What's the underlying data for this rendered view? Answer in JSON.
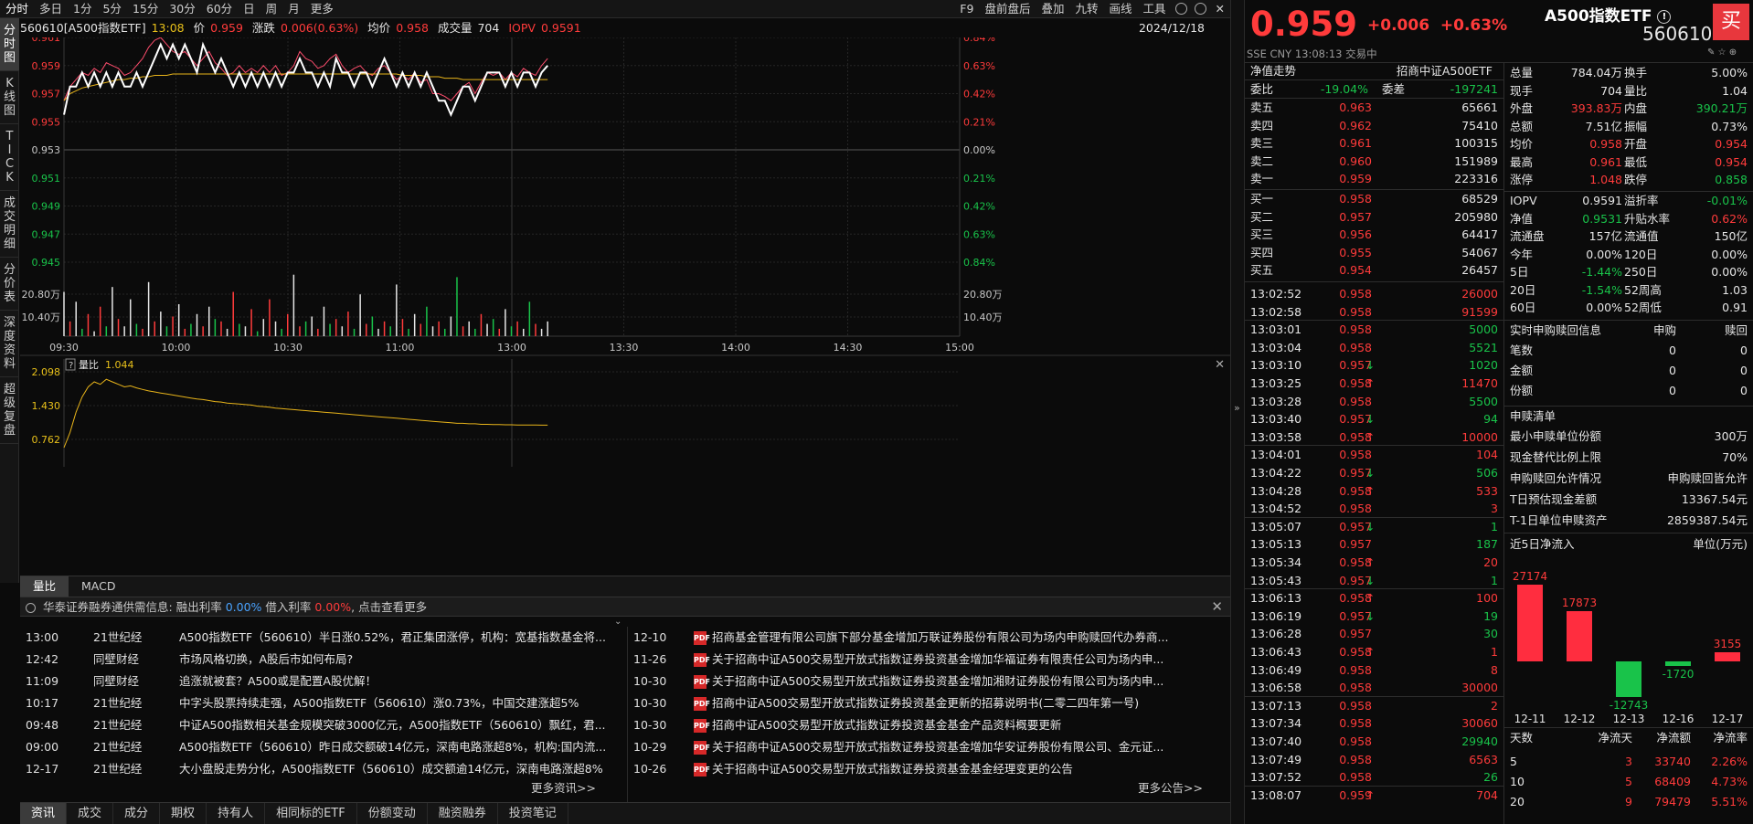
{
  "toolbar": {
    "periods": [
      "分时",
      "多日",
      "1分",
      "5分",
      "15分",
      "30分",
      "60分",
      "日",
      "周",
      "月",
      "更多"
    ],
    "right": [
      "F9",
      "盘前盘后",
      "叠加",
      "九转",
      "画线",
      "工具"
    ]
  },
  "rail_tabs": [
    "分时图",
    "K线图",
    "TICK",
    "成交明细",
    "分价表",
    "深度资料",
    "超级复盘"
  ],
  "chart_header": {
    "symbol": "560610[A500指数ETF]",
    "time": "13:08",
    "price_label": "价",
    "price": "0.959",
    "change_label": "涨跌",
    "change": "0.006(0.63%)",
    "avg_label": "均价",
    "avg": "0.958",
    "vol_label": "成交量",
    "vol": "704",
    "iopv_label": "IOPV",
    "iopv": "0.9591",
    "date": "2024/12/18"
  },
  "chart_data": {
    "type": "line",
    "price_axis": {
      "left_ticks": [
        "0.961",
        "0.959",
        "0.957",
        "0.955",
        "0.953",
        "0.951",
        "0.949",
        "0.947",
        "0.945"
      ],
      "right_ticks": [
        "0.84%",
        "0.63%",
        "0.42%",
        "0.21%",
        "0.00%",
        "0.21%",
        "0.42%",
        "0.63%",
        "0.84%"
      ],
      "ylim": [
        0.945,
        0.961
      ],
      "prev_close": 0.953
    },
    "volume_axis": {
      "ticks": [
        "20.80万",
        "10.40万"
      ],
      "right_ticks": [
        "20.80万",
        "10.40万"
      ]
    },
    "x_ticks": [
      "09:30",
      "10:00",
      "10:30",
      "11:00",
      "13:00",
      "13:30",
      "14:00",
      "14:30",
      "15:00"
    ],
    "price_series": [
      0.9555,
      0.9575,
      0.9575,
      0.9585,
      0.9575,
      0.9585,
      0.9575,
      0.9585,
      0.9575,
      0.9585,
      0.9575,
      0.9575,
      0.9585,
      0.9575,
      0.9585,
      0.9595,
      0.9605,
      0.9595,
      0.9605,
      0.9595,
      0.9605,
      0.9595,
      0.9585,
      0.9605,
      0.9595,
      0.9585,
      0.9595,
      0.9585,
      0.9575,
      0.9585,
      0.9575,
      0.9585,
      0.9575,
      0.9585,
      0.9575,
      0.9585,
      0.9575,
      0.9585,
      0.9585,
      0.9595,
      0.9585,
      0.9585,
      0.9575,
      0.9585,
      0.9575,
      0.9595,
      0.9585,
      0.9585,
      0.9575,
      0.9585,
      0.9585,
      0.9575,
      0.9585,
      0.9595,
      0.9585,
      0.9575,
      0.9585,
      0.9575,
      0.9585,
      0.9575,
      0.9585,
      0.9575,
      0.9565,
      0.9565,
      0.9555,
      0.9565,
      0.9575,
      0.9575,
      0.9565,
      0.9575,
      0.9585,
      0.9585,
      0.9585,
      0.9575,
      0.9585,
      0.9575,
      0.9585,
      0.9585,
      0.9575,
      0.9585,
      0.959
    ],
    "iopv_series": [
      0.9565,
      0.9575,
      0.958,
      0.9585,
      0.9583,
      0.9588,
      0.9585,
      0.9592,
      0.959,
      0.9588,
      0.9583,
      0.9585,
      0.959,
      0.9595,
      0.9603,
      0.9608,
      0.961,
      0.9605,
      0.96,
      0.9598,
      0.96,
      0.9595,
      0.959,
      0.9595,
      0.96,
      0.9592,
      0.9588,
      0.9583,
      0.9585,
      0.959,
      0.9585,
      0.9588,
      0.9585,
      0.959,
      0.9585,
      0.959,
      0.9583,
      0.9585,
      0.959,
      0.96,
      0.9595,
      0.9593,
      0.9588,
      0.959,
      0.9595,
      0.9598,
      0.959,
      0.9585,
      0.9588,
      0.959,
      0.9585,
      0.9583,
      0.9588,
      0.959,
      0.9585,
      0.958,
      0.9583,
      0.958,
      0.9585,
      0.9578,
      0.958,
      0.957,
      0.957,
      0.9568,
      0.9565,
      0.957,
      0.9575,
      0.9578,
      0.957,
      0.9578,
      0.9585,
      0.9583,
      0.9585,
      0.958,
      0.9585,
      0.9582,
      0.9588,
      0.9585,
      0.9583,
      0.959,
      0.9595
    ],
    "avg_series": [
      0.9565,
      0.957,
      0.9572,
      0.9574,
      0.9575,
      0.9576,
      0.9577,
      0.9578,
      0.9579,
      0.958,
      0.958,
      0.9581,
      0.9581,
      0.9582,
      0.9582,
      0.9583,
      0.9583,
      0.9583,
      0.9584,
      0.9584,
      0.9584,
      0.9584,
      0.9584,
      0.9584,
      0.9584,
      0.9584,
      0.9584,
      0.9584,
      0.9584,
      0.9584,
      0.9584,
      0.9584,
      0.9584,
      0.9584,
      0.9584,
      0.9584,
      0.9584,
      0.9584,
      0.9584,
      0.9584,
      0.9584,
      0.9584,
      0.9584,
      0.9584,
      0.9584,
      0.9584,
      0.9584,
      0.9584,
      0.9584,
      0.9584,
      0.9584,
      0.9584,
      0.9584,
      0.9584,
      0.9584,
      0.9584,
      0.9583,
      0.9583,
      0.9583,
      0.9583,
      0.9582,
      0.9582,
      0.9582,
      0.9581,
      0.9581,
      0.9581,
      0.958,
      0.958,
      0.958,
      0.958,
      0.958,
      0.958,
      0.958,
      0.958,
      0.958,
      0.958,
      0.958,
      0.958,
      0.958,
      0.958,
      0.958
    ],
    "volume_series": [
      18,
      6,
      14,
      3,
      9,
      2,
      12,
      4,
      20,
      7,
      4,
      15,
      5,
      3,
      22,
      6,
      10,
      4,
      8,
      13,
      3,
      5,
      9,
      4,
      12,
      7,
      6,
      3,
      18,
      5,
      4,
      11,
      2,
      7,
      15,
      6,
      3,
      9,
      25,
      4,
      6,
      8,
      3,
      12,
      5,
      7,
      4,
      10,
      3,
      17,
      5,
      8,
      3,
      6,
      4,
      21,
      7,
      3,
      9,
      5,
      12,
      4,
      6,
      3,
      8,
      24,
      4,
      6,
      3,
      9,
      5,
      7,
      3,
      11,
      4,
      6,
      3,
      14,
      5,
      3,
      6
    ],
    "volume_colors": [
      "w",
      "r",
      "w",
      "g",
      "r",
      "w",
      "r",
      "g",
      "w",
      "r",
      "w",
      "w",
      "g",
      "r",
      "w",
      "r",
      "w",
      "g",
      "r",
      "w",
      "r",
      "g",
      "w",
      "r",
      "w",
      "g",
      "r",
      "w",
      "r",
      "g",
      "w",
      "r",
      "g",
      "w",
      "r",
      "w",
      "g",
      "r",
      "w",
      "r",
      "g",
      "w",
      "r",
      "w",
      "g",
      "r",
      "w",
      "r",
      "g",
      "w",
      "r",
      "g",
      "w",
      "r",
      "g",
      "w",
      "r",
      "g",
      "w",
      "r",
      "g",
      "w",
      "r",
      "g",
      "w",
      "g",
      "r",
      "w",
      "g",
      "r",
      "w",
      "g",
      "r",
      "w",
      "g",
      "r",
      "w",
      "g",
      "r",
      "w",
      "w"
    ],
    "ratio_panel": {
      "label": "量比",
      "value": "1.044",
      "ticks": [
        "2.098",
        "1.430",
        "0.762"
      ],
      "series": [
        0.6,
        0.9,
        1.3,
        1.6,
        1.8,
        1.9,
        1.85,
        1.95,
        1.9,
        1.85,
        1.8,
        1.82,
        1.78,
        1.75,
        1.72,
        1.7,
        1.68,
        1.66,
        1.64,
        1.62,
        1.6,
        1.58,
        1.56,
        1.55,
        1.53,
        1.51,
        1.5,
        1.48,
        1.47,
        1.46,
        1.45,
        1.44,
        1.42,
        1.41,
        1.4,
        1.38,
        1.37,
        1.36,
        1.35,
        1.34,
        1.33,
        1.32,
        1.31,
        1.3,
        1.29,
        1.28,
        1.27,
        1.26,
        1.25,
        1.24,
        1.23,
        1.22,
        1.21,
        1.2,
        1.19,
        1.18,
        1.17,
        1.16,
        1.15,
        1.14,
        1.13,
        1.12,
        1.11,
        1.1,
        1.09,
        1.08,
        1.08,
        1.07,
        1.07,
        1.06,
        1.06,
        1.055,
        1.055,
        1.05,
        1.05,
        1.048,
        1.046,
        1.045,
        1.045,
        1.044,
        1.044
      ]
    }
  },
  "indicator_tabs": [
    "量比",
    "MACD"
  ],
  "margin_bar": {
    "label": "华泰证券融券通供需信息:",
    "lend_label": "融出利率",
    "lend_value": "0.00%",
    "borrow_label": "借入利率",
    "borrow_value": "0.00%",
    "link": "点击查看更多"
  },
  "news": [
    {
      "time": "13:00",
      "source": "21世纪经",
      "title": "A500指数ETF（560610）半日涨0.52%，君正集团涨停，机构：宽基指数基金将..."
    },
    {
      "time": "12:42",
      "source": "同壁财经",
      "title": "市场风格切换，A股后市如何布局?"
    },
    {
      "time": "11:09",
      "source": "同壁财经",
      "title": "追涨就被套？A500或是配置A股优解！"
    },
    {
      "time": "10:17",
      "source": "21世纪经",
      "title": "中字头股票持续走强，A500指数ETF（560610）涨0.73%，中国交建涨超5%"
    },
    {
      "time": "09:48",
      "source": "21世纪经",
      "title": "中证A500指数相关基金规模突破3000亿元，A500指数ETF（560610）飘红，君..."
    },
    {
      "time": "09:00",
      "source": "21世纪经",
      "title": "A500指数ETF（560610）昨日成交额破14亿元，深南电路涨超8%，机构:国内流..."
    },
    {
      "time": "12-17",
      "source": "21世纪经",
      "title": "大小盘股走势分化，A500指数ETF（560610）成交额逾14亿元，深南电路涨超8%"
    }
  ],
  "news_more": "更多资讯>>",
  "announcements": [
    {
      "date": "12-10",
      "title": "招商基金管理有限公司旗下部分基金增加万联证券股份有限公司为场内申购赎回代办券商..."
    },
    {
      "date": "11-26",
      "title": "关于招商中证A500交易型开放式指数证券投资基金增加华福证券有限责任公司为场内申..."
    },
    {
      "date": "10-30",
      "title": "关于招商中证A500交易型开放式指数证券投资基金增加湘财证券股份有限公司为场内申..."
    },
    {
      "date": "10-30",
      "title": "招商中证A500交易型开放式指数证券投资基金更新的招募说明书(二零二四年第一号)"
    },
    {
      "date": "10-30",
      "title": "招商中证A500交易型开放式指数证券投资基金基金产品资料概要更新"
    },
    {
      "date": "10-29",
      "title": "关于招商中证A500交易型开放式指数证券投资基金增加华安证券股份有限公司、金元证..."
    },
    {
      "date": "10-26",
      "title": "关于招商中证A500交易型开放式指数证券投资基金基金经理变更的公告"
    }
  ],
  "ann_more": "更多公告>>",
  "bottom_tabs": [
    "资讯",
    "成交",
    "成分",
    "期权",
    "持有人",
    "相同标的ETF",
    "份额变动",
    "融资融券",
    "投资笔记"
  ],
  "quote": {
    "price": "0.959",
    "change": "+0.006",
    "pct": "+0.63%",
    "name": "A500指数ETF",
    "code": "560610",
    "buy_label": "买",
    "sub": "SSE  CNY  13:08:13  交易中",
    "nav_tab": "净值走势",
    "index_name": "招商中证A500ETF"
  },
  "book": {
    "ratio_label": "委比",
    "ratio": "-19.04%",
    "diff_label": "委差",
    "diff": "-197241",
    "asks": [
      {
        "l": "卖五",
        "p": "0.963",
        "v": "65661"
      },
      {
        "l": "卖四",
        "p": "0.962",
        "v": "75410"
      },
      {
        "l": "卖三",
        "p": "0.961",
        "v": "100315"
      },
      {
        "l": "卖二",
        "p": "0.960",
        "v": "151989"
      },
      {
        "l": "卖一",
        "p": "0.959",
        "v": "223316"
      }
    ],
    "bids": [
      {
        "l": "买一",
        "p": "0.958",
        "v": "68529"
      },
      {
        "l": "买二",
        "p": "0.957",
        "v": "205980"
      },
      {
        "l": "买三",
        "p": "0.956",
        "v": "64417"
      },
      {
        "l": "买四",
        "p": "0.955",
        "v": "54067"
      },
      {
        "l": "买五",
        "p": "0.954",
        "v": "26457"
      }
    ]
  },
  "ticks": [
    {
      "t": "13:02:52",
      "p": "0.958",
      "v": "26000",
      "d": "",
      "c": "r"
    },
    {
      "t": "13:02:58",
      "p": "0.958",
      "v": "91599",
      "d": "",
      "c": "r"
    },
    {
      "t": "13:03:01",
      "p": "0.958",
      "v": "5000",
      "d": "",
      "c": "g"
    },
    {
      "t": "13:03:04",
      "p": "0.958",
      "v": "5521",
      "d": "",
      "c": "g"
    },
    {
      "t": "13:03:10",
      "p": "0.957",
      "v": "1020",
      "d": "↓",
      "c": "g"
    },
    {
      "t": "13:03:25",
      "p": "0.958",
      "v": "11470",
      "d": "↑",
      "c": "r"
    },
    {
      "t": "13:03:28",
      "p": "0.958",
      "v": "5500",
      "d": "",
      "c": "g"
    },
    {
      "t": "13:03:40",
      "p": "0.957",
      "v": "94",
      "d": "↓",
      "c": "g"
    },
    {
      "t": "13:03:58",
      "p": "0.958",
      "v": "10000",
      "d": "↑",
      "c": "r"
    },
    {
      "t": "13:04:01",
      "p": "0.958",
      "v": "104",
      "d": "",
      "c": "r"
    },
    {
      "t": "13:04:22",
      "p": "0.957",
      "v": "506",
      "d": "↓",
      "c": "g"
    },
    {
      "t": "13:04:28",
      "p": "0.958",
      "v": "533",
      "d": "↑",
      "c": "r"
    },
    {
      "t": "13:04:52",
      "p": "0.958",
      "v": "3",
      "d": "",
      "c": "r"
    },
    {
      "t": "13:05:07",
      "p": "0.957",
      "v": "1",
      "d": "↓",
      "c": "g"
    },
    {
      "t": "13:05:13",
      "p": "0.957",
      "v": "187",
      "d": "",
      "c": "g"
    },
    {
      "t": "13:05:34",
      "p": "0.958",
      "v": "20",
      "d": "↑",
      "c": "r"
    },
    {
      "t": "13:05:43",
      "p": "0.957",
      "v": "1",
      "d": "↓",
      "c": "g"
    },
    {
      "t": "13:06:13",
      "p": "0.958",
      "v": "100",
      "d": "↑",
      "c": "r"
    },
    {
      "t": "13:06:19",
      "p": "0.957",
      "v": "19",
      "d": "↓",
      "c": "g"
    },
    {
      "t": "13:06:28",
      "p": "0.957",
      "v": "30",
      "d": "",
      "c": "g"
    },
    {
      "t": "13:06:43",
      "p": "0.958",
      "v": "1",
      "d": "↑",
      "c": "r"
    },
    {
      "t": "13:06:49",
      "p": "0.958",
      "v": "8",
      "d": "",
      "c": "r"
    },
    {
      "t": "13:06:58",
      "p": "0.958",
      "v": "30000",
      "d": "",
      "c": "r"
    },
    {
      "t": "13:07:13",
      "p": "0.958",
      "v": "2",
      "d": "",
      "c": "r"
    },
    {
      "t": "13:07:34",
      "p": "0.958",
      "v": "30060",
      "d": "",
      "c": "r"
    },
    {
      "t": "13:07:40",
      "p": "0.958",
      "v": "29940",
      "d": "",
      "c": "g"
    },
    {
      "t": "13:07:49",
      "p": "0.958",
      "v": "6563",
      "d": "",
      "c": "r"
    },
    {
      "t": "13:07:52",
      "p": "0.958",
      "v": "26",
      "d": "",
      "c": "g"
    },
    {
      "t": "13:08:07",
      "p": "0.959",
      "v": "704",
      "d": "↑",
      "c": "r"
    }
  ],
  "stats": [
    [
      {
        "l": "总量",
        "v": "784.04万",
        "c": "w"
      },
      {
        "l": "换手",
        "v": "5.00%",
        "c": "w"
      }
    ],
    [
      {
        "l": "现手",
        "v": "704",
        "c": "w"
      },
      {
        "l": "量比",
        "v": "1.04",
        "c": "w"
      }
    ],
    [
      {
        "l": "外盘",
        "v": "393.83万",
        "c": "r"
      },
      {
        "l": "内盘",
        "v": "390.21万",
        "c": "g"
      }
    ],
    [
      {
        "l": "总额",
        "v": "7.51亿",
        "c": "w"
      },
      {
        "l": "振幅",
        "v": "0.73%",
        "c": "w"
      }
    ],
    [
      {
        "l": "均价",
        "v": "0.958",
        "c": "r"
      },
      {
        "l": "开盘",
        "v": "0.954",
        "c": "r"
      }
    ],
    [
      {
        "l": "最高",
        "v": "0.961",
        "c": "r"
      },
      {
        "l": "最低",
        "v": "0.954",
        "c": "r"
      }
    ],
    [
      {
        "l": "涨停",
        "v": "1.048",
        "c": "r"
      },
      {
        "l": "跌停",
        "v": "0.858",
        "c": "g"
      }
    ]
  ],
  "stats2": [
    [
      {
        "l": "IOPV",
        "v": "0.9591",
        "c": "w"
      },
      {
        "l": "溢折率",
        "v": "-0.01%",
        "c": "g"
      }
    ],
    [
      {
        "l": "净值",
        "v": "0.9531",
        "c": "g"
      },
      {
        "l": "升贴水率",
        "v": "0.62%",
        "c": "r"
      }
    ],
    [
      {
        "l": "流通盘",
        "v": "157亿",
        "c": "w"
      },
      {
        "l": "流通值",
        "v": "150亿",
        "c": "w"
      }
    ],
    [
      {
        "l": "今年",
        "v": "0.00%",
        "c": "w"
      },
      {
        "l": "120日",
        "v": "0.00%",
        "c": "w"
      }
    ],
    [
      {
        "l": "5日",
        "v": "-1.44%",
        "c": "g"
      },
      {
        "l": "250日",
        "v": "0.00%",
        "c": "w"
      }
    ],
    [
      {
        "l": "20日",
        "v": "-1.54%",
        "c": "g"
      },
      {
        "l": "52周高",
        "v": "1.03",
        "c": "w"
      }
    ],
    [
      {
        "l": "60日",
        "v": "0.00%",
        "c": "w"
      },
      {
        "l": "52周低",
        "v": "0.91",
        "c": "w"
      }
    ]
  ],
  "redeem": {
    "title": "实时申购赎回信息",
    "col1": "申购",
    "col2": "赎回",
    "rows": [
      {
        "l": "笔数",
        "a": "0",
        "b": "0"
      },
      {
        "l": "金额",
        "a": "0",
        "b": "0"
      },
      {
        "l": "份额",
        "a": "0",
        "b": "0"
      }
    ]
  },
  "list": {
    "title": "申赎清单",
    "rows": [
      {
        "l": "最小申赎单位份额",
        "v": "300万"
      },
      {
        "l": "现金替代比例上限",
        "v": "70%"
      },
      {
        "l": "申购赎回允许情况",
        "v": "申购赎回皆允许"
      },
      {
        "l": "T日预估现金差额",
        "v": "13367.54元"
      },
      {
        "l": "T-1日单位申赎资产",
        "v": "2859387.54元"
      }
    ]
  },
  "inflow": {
    "title": "近5日净流入",
    "unit": "单位(万元)",
    "dates": [
      "12-11",
      "12-12",
      "12-13",
      "12-16",
      "12-17"
    ],
    "values": [
      27174,
      17873,
      -12743,
      -1720,
      3155
    ],
    "headers": [
      "天数",
      "净流天",
      "净流额",
      "净流率"
    ],
    "rows": [
      {
        "d": "5",
        "n": "3",
        "a": "33740",
        "r": "2.26%"
      },
      {
        "d": "10",
        "n": "5",
        "a": "68409",
        "r": "4.73%"
      },
      {
        "d": "20",
        "n": "9",
        "a": "79479",
        "r": "5.51%"
      }
    ]
  }
}
